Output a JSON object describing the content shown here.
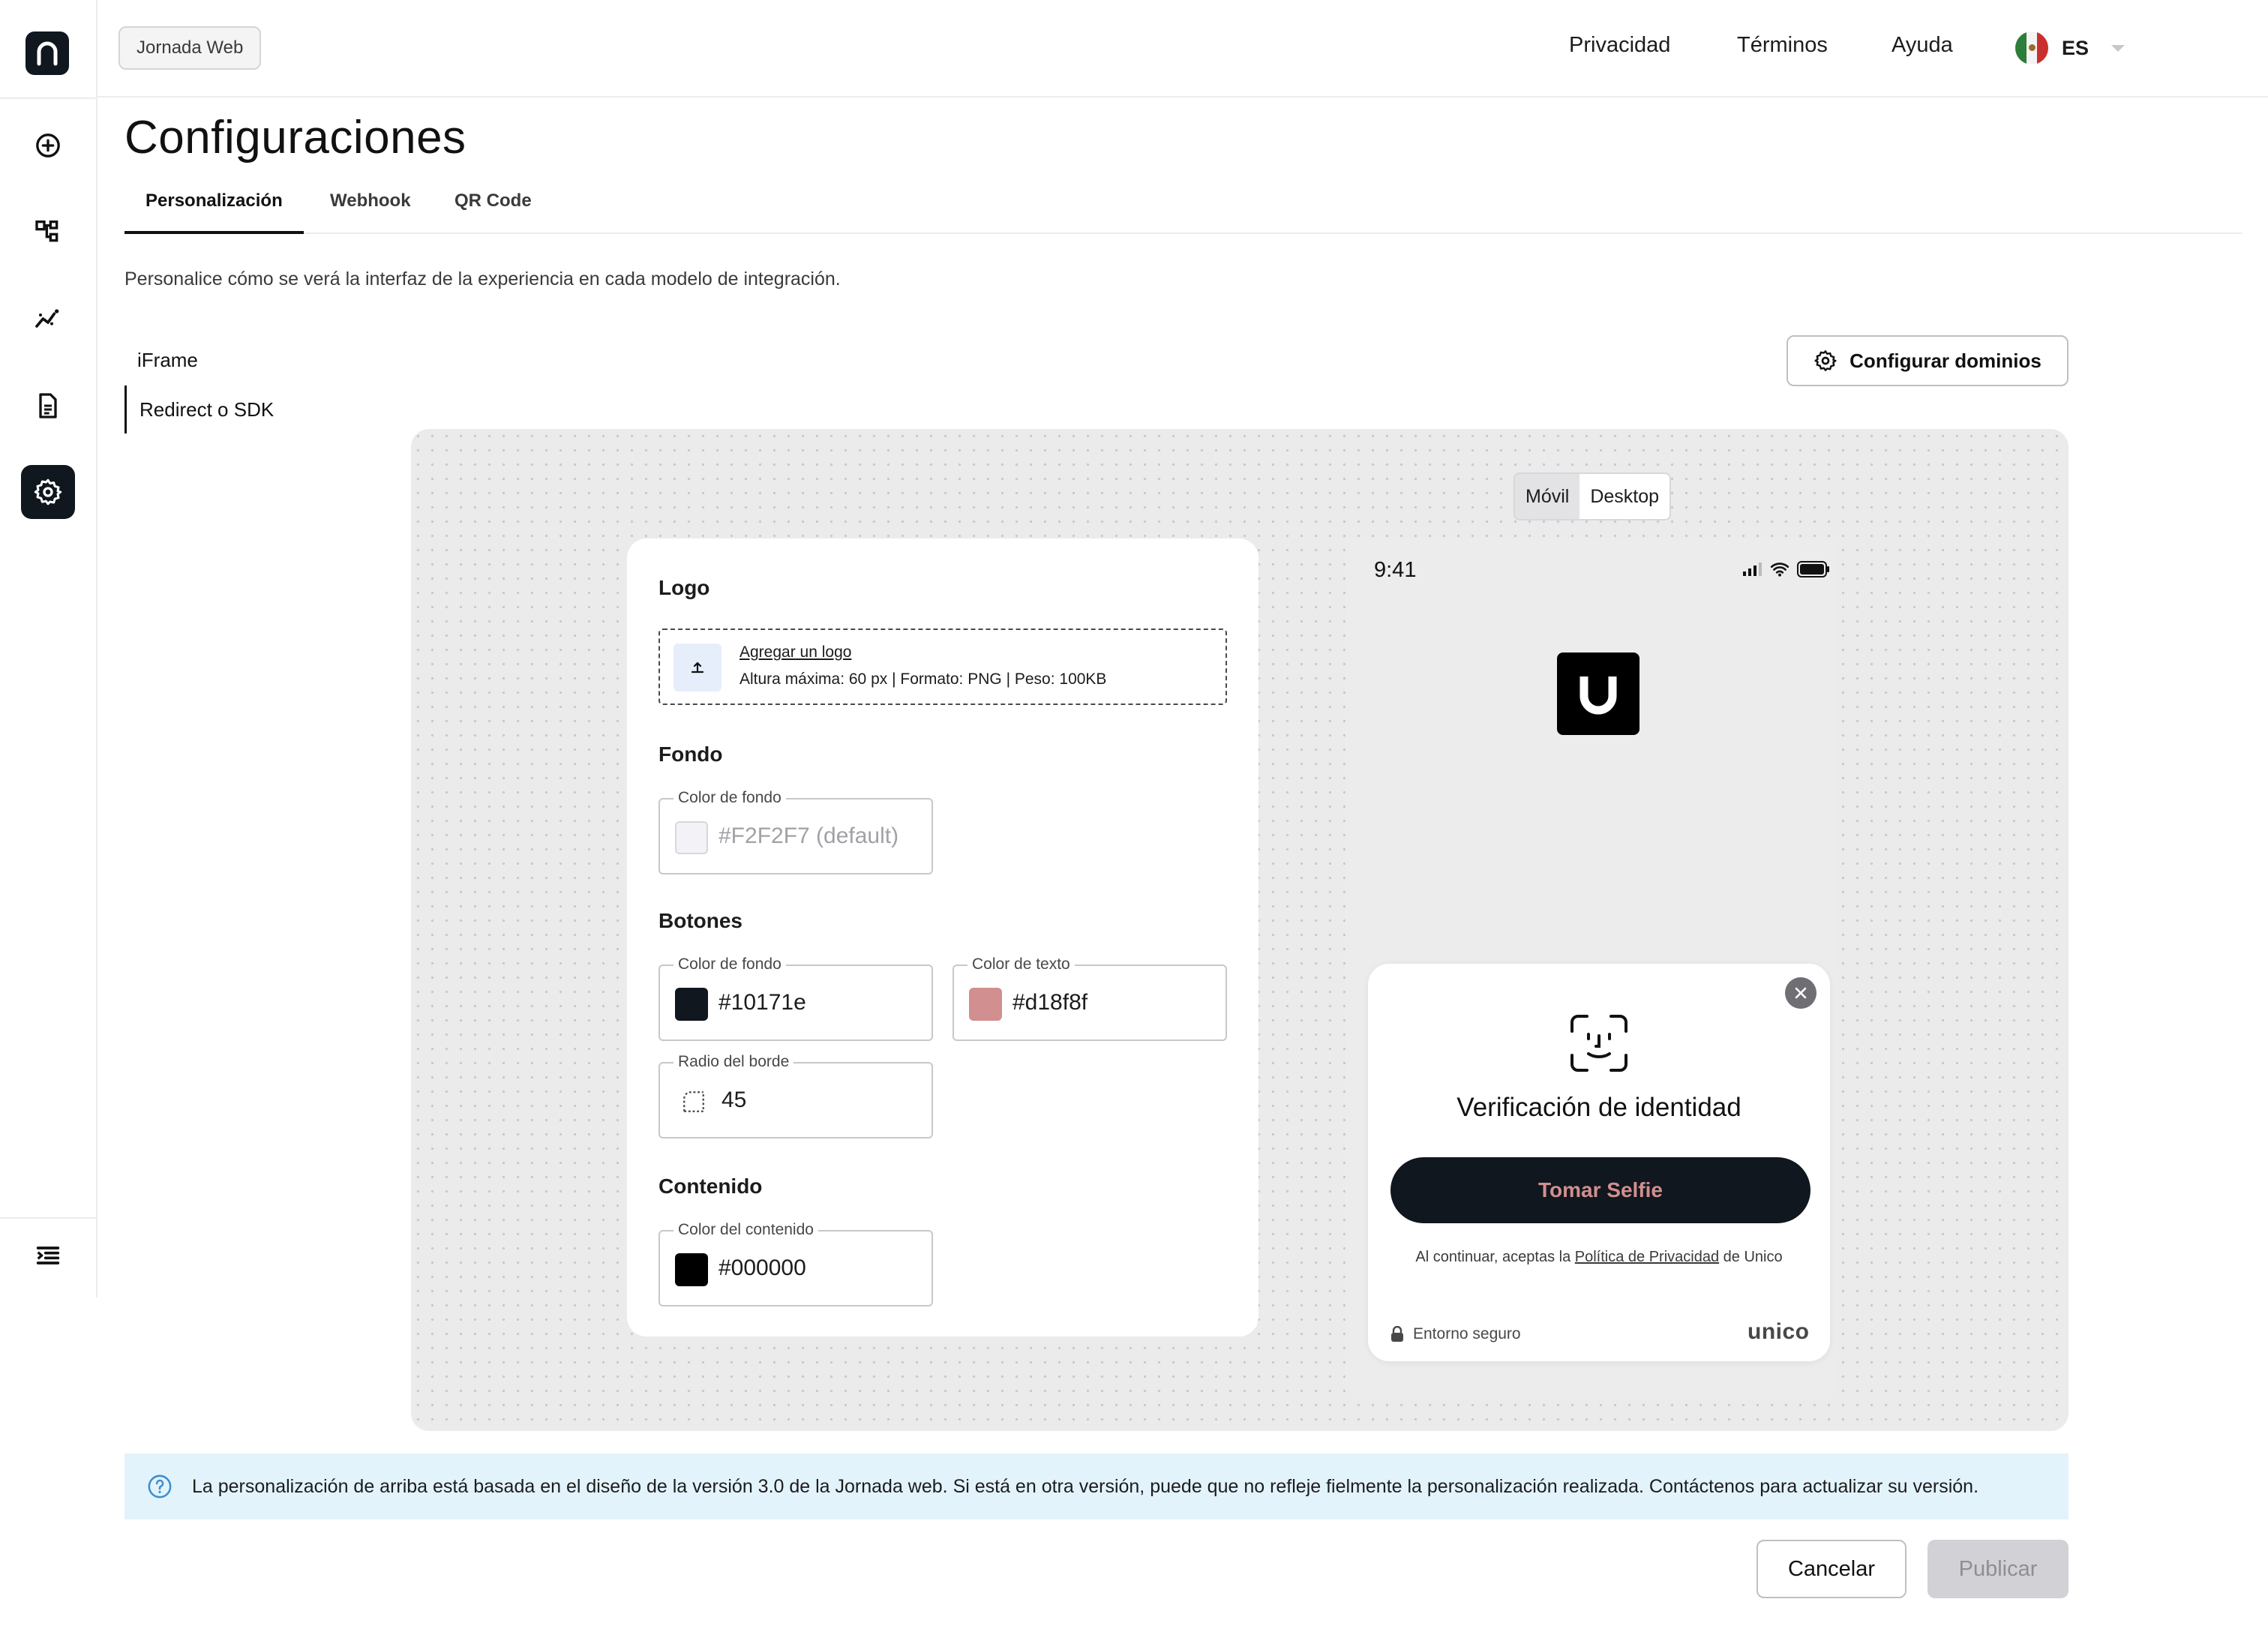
{
  "header": {
    "app_chip": "Jornada Web",
    "links": [
      "Privacidad",
      "Términos",
      "Ayuda"
    ],
    "language": {
      "code": "ES",
      "flag_icon": "mexico-flag-icon"
    },
    "avatar_icon": "user-avatar-icon"
  },
  "sidebar": {
    "logo_icon": "n-logo-icon",
    "items": [
      {
        "icon": "add-circle-icon",
        "active": false
      },
      {
        "icon": "flow-diagram-icon",
        "active": false
      },
      {
        "icon": "analytics-chart-icon",
        "active": false
      },
      {
        "icon": "document-icon",
        "active": false
      },
      {
        "icon": "settings-gear-icon",
        "active": true
      }
    ],
    "collapse_icon": "collapse-menu-icon"
  },
  "page": {
    "title": "Configuraciones",
    "tabs": [
      {
        "label": "Personalización",
        "active": true
      },
      {
        "label": "Webhook",
        "active": false
      },
      {
        "label": "QR Code",
        "active": false
      }
    ],
    "description": "Personalice cómo se verá la interfaz de la experiencia en cada modelo de integración."
  },
  "integration": {
    "options": [
      {
        "label": "iFrame",
        "active": false
      },
      {
        "label": "Redirect o SDK",
        "active": true
      }
    ],
    "configure_domains": "Configurar dominios"
  },
  "preview_mode": {
    "options": [
      "Móvil",
      "Desktop"
    ],
    "selected": "Móvil"
  },
  "settings": {
    "logo": {
      "title": "Logo",
      "upload_link": "Agregar un logo",
      "upload_hint": "Altura máxima: 60 px | Formato: PNG | Peso: 100KB"
    },
    "background": {
      "title": "Fondo",
      "color_label": "Color de fondo",
      "color_value": "#F2F2F7 (default)",
      "swatch": "#f2f2f7"
    },
    "buttons": {
      "title": "Botones",
      "bg_label": "Color de fondo",
      "bg_value": "#10171e",
      "text_label": "Color de texto",
      "text_value": "#d18f8f",
      "radius_label": "Radio del borde",
      "radius_value": "45"
    },
    "content": {
      "title": "Contenido",
      "color_label": "Color del contenido",
      "color_value": "#000000"
    }
  },
  "phone_preview": {
    "time": "9:41",
    "sheet_title": "Verificación de identidad",
    "button": "Tomar Selfie",
    "consent_prefix": "Al continuar, aceptas la ",
    "consent_link": "Política de Privacidad",
    "consent_suffix": " de Unico",
    "secure_label": "Entorno seguro",
    "brand": "unico"
  },
  "banner": {
    "text": "La personalización de arriba está basada en el diseño de la versión 3.0 de la Jornada web. Si está en otra versión, puede que no refleje fielmente la personalización realizada. Contáctenos para actualizar su versión."
  },
  "footer": {
    "cancel": "Cancelar",
    "publish": "Publicar"
  }
}
